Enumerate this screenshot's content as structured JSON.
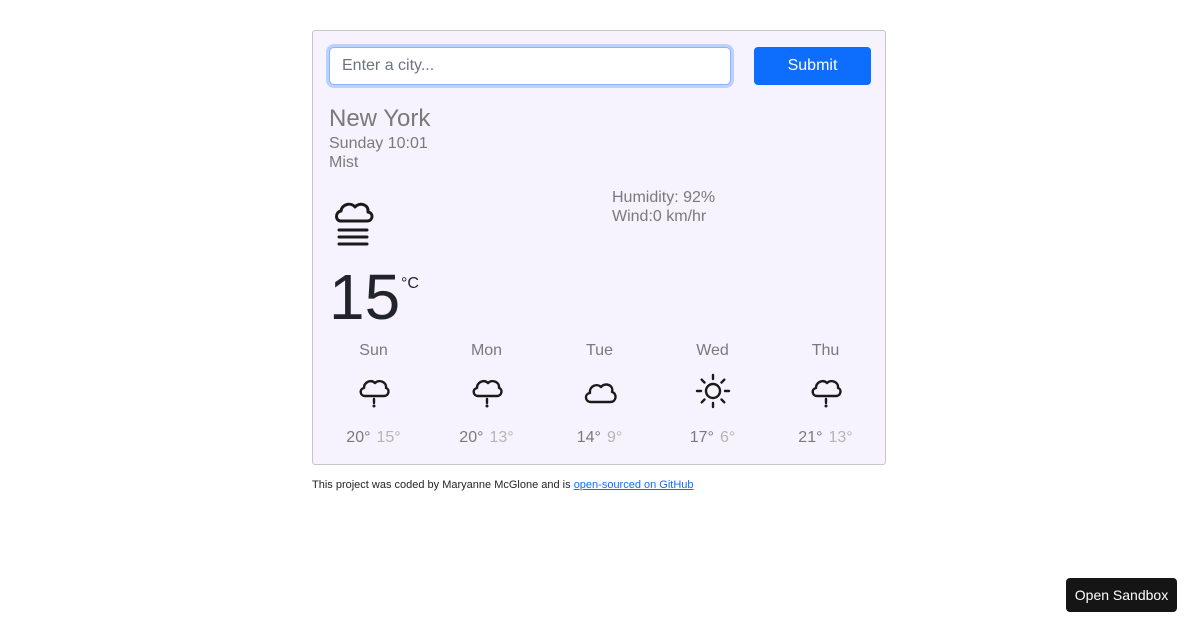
{
  "search": {
    "placeholder": "Enter a city...",
    "value": "",
    "submit_label": "Submit"
  },
  "current": {
    "city": "New York",
    "date": "Sunday 10:01",
    "description": "Mist",
    "humidity": "Humidity: 92%",
    "wind": "Wind:0 km/hr",
    "temperature": "15",
    "unit": "°C",
    "icon": "mist-icon"
  },
  "forecast": [
    {
      "day": "Sun",
      "max": "20°",
      "min": "15°",
      "icon": "rain-icon"
    },
    {
      "day": "Mon",
      "max": "20°",
      "min": "13°",
      "icon": "rain-icon"
    },
    {
      "day": "Tue",
      "max": "14°",
      "min": "9°",
      "icon": "cloud-icon"
    },
    {
      "day": "Wed",
      "max": "17°",
      "min": "6°",
      "icon": "sun-icon"
    },
    {
      "day": "Thu",
      "max": "21°",
      "min": "13°",
      "icon": "rain-icon"
    }
  ],
  "footer": {
    "text": "This project was coded by Maryanne McGlone and is ",
    "link_label": "open-sourced on GitHub"
  },
  "sandbox": {
    "label": "Open Sandbox"
  },
  "colors": {
    "accent": "#0d6efd",
    "card_bg": "#f7f3fe",
    "muted_text": "#7a7a7a"
  }
}
